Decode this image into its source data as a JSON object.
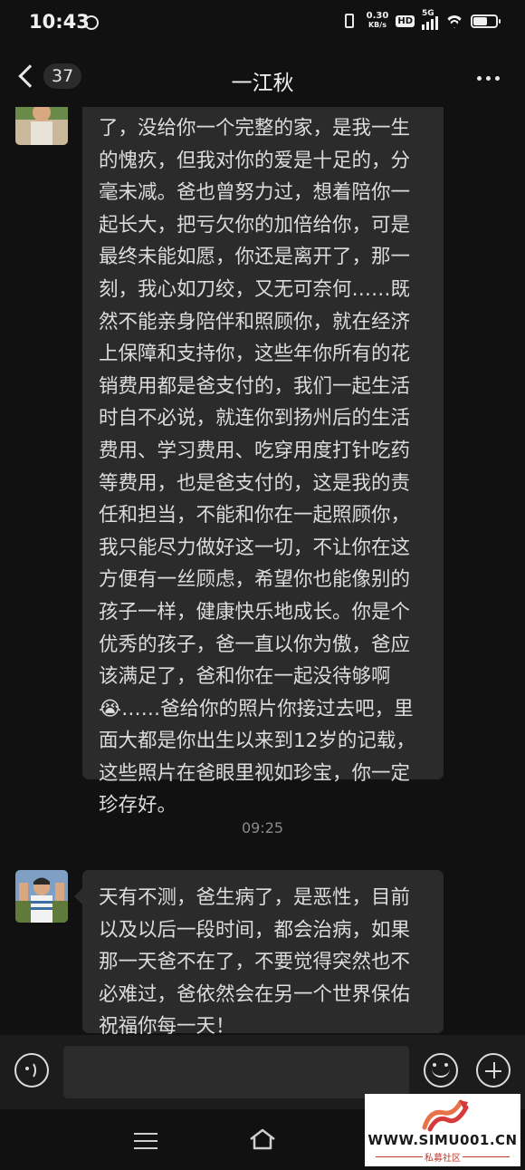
{
  "status_bar": {
    "time": "10:43",
    "net_speed_value": "0.30",
    "net_speed_unit": "KB/s",
    "hd_label": "HD",
    "network_label": "5G"
  },
  "header": {
    "back_count": "37",
    "title": "一江秋"
  },
  "messages": [
    {
      "sender": "contact",
      "text": "了，没给你一个完整的家，是我一生的愧疚，但我对你的爱是十足的，分毫未减。爸也曾努力过，想着陪你一起长大，把亏欠你的加倍给你，可是最终未能如愿，你还是离开了，那一刻，我心如刀绞，又无可奈何……既然不能亲身陪伴和照顾你，就在经济上保障和支持你，这些年你所有的花销费用都是爸支付的，我们一起生活时自不必说，就连你到扬州后的生活费用、学习费用、吃穿用度打针吃药等费用，也是爸支付的，这是我的责任和担当，不能和你在一起照顾你，我只能尽力做好这一切，不让你在这方便有一丝顾虑，希望你也能像别的孩子一样，健康快乐地成长。你是个优秀的孩子，爸一直以你为傲，爸应该满足了，爸和你在一起没待够啊😭……爸给你的照片你接过去吧，里面大都是你出生以来到12岁的记载，这些照片在爸眼里视如珍宝，你一定珍存好。"
    },
    {
      "sender": "contact",
      "text": "天有不测，爸生病了，是恶性，目前以及以后一段时间，都会治病，如果那一天爸不在了，不要觉得突然也不必难过，爸依然会在另一个世界保佑祝福你每一天！"
    }
  ],
  "timestamp": "09:25",
  "input": {
    "value": "",
    "placeholder": ""
  },
  "watermark": {
    "url": "WWW.SIMU001.CN",
    "subtitle": "私募社区"
  },
  "colors": {
    "background": "#111111",
    "bubble": "#2b2b2b",
    "text": "#dcdcdc",
    "timestamp": "#8a8a8a",
    "watermark_red": "#c0392b"
  },
  "icons": [
    "back-chevron-icon",
    "more-icon",
    "voice-icon",
    "emoji-icon",
    "plus-icon",
    "menu-icon",
    "home-icon"
  ]
}
